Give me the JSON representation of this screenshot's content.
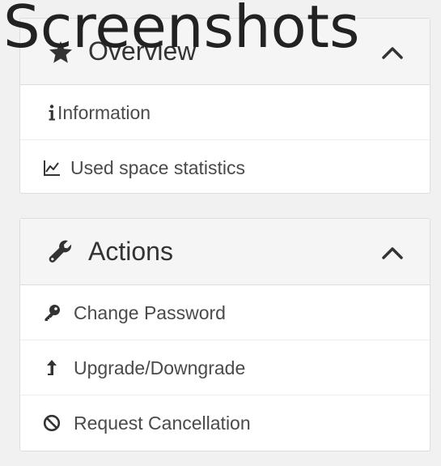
{
  "page_title": "Screenshots",
  "overview_panel": {
    "title": "Overview",
    "icon": "star-icon",
    "items": [
      {
        "label": "Information",
        "icon": "info-icon"
      },
      {
        "label": "Used space statistics",
        "icon": "line-chart-icon"
      }
    ]
  },
  "actions_panel": {
    "title": "Actions",
    "icon": "wrench-icon",
    "items": [
      {
        "label": "Change Password",
        "icon": "key-icon"
      },
      {
        "label": "Upgrade/Downgrade",
        "icon": "level-up-icon"
      },
      {
        "label": "Request Cancellation",
        "icon": "ban-icon"
      }
    ]
  },
  "colors": {
    "page_background": "#f1f1f1",
    "panel_background": "#ffffff",
    "heading_background": "#f5f5f5",
    "border": "#dddddd",
    "text": "#333333"
  }
}
